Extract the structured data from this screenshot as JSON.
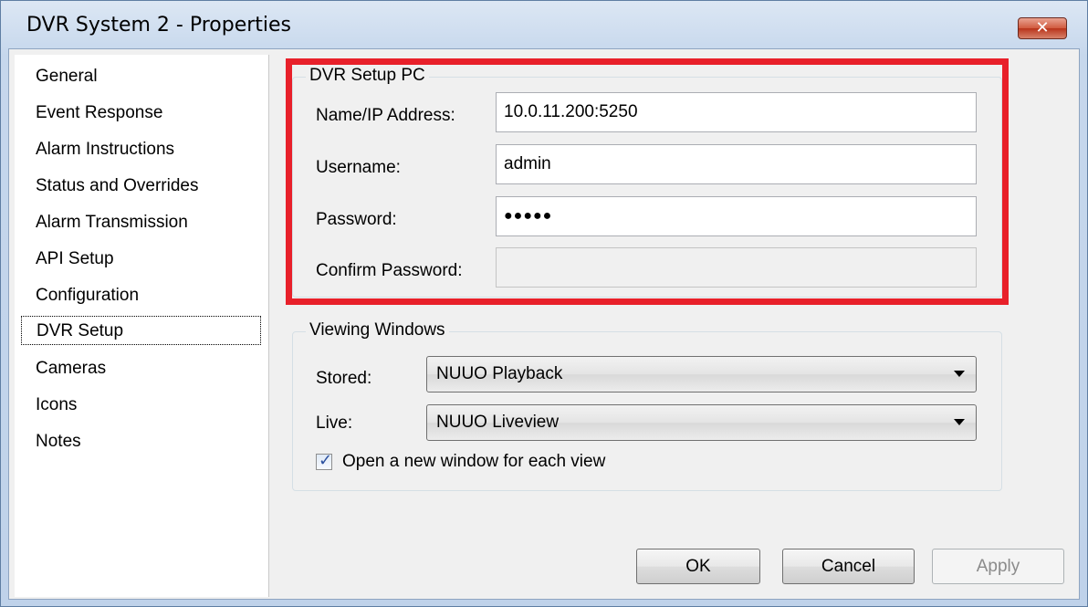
{
  "window": {
    "title": "DVR System 2 - Properties",
    "close_glyph": "✕"
  },
  "sidebar": {
    "items": [
      {
        "label": "General"
      },
      {
        "label": "Event Response"
      },
      {
        "label": "Alarm Instructions"
      },
      {
        "label": "Status and Overrides"
      },
      {
        "label": "Alarm Transmission"
      },
      {
        "label": "API Setup"
      },
      {
        "label": "Configuration"
      },
      {
        "label": "DVR Setup",
        "selected": true
      },
      {
        "label": "Cameras"
      },
      {
        "label": "Icons"
      },
      {
        "label": "Notes"
      }
    ]
  },
  "dvr_setup_pc": {
    "group_label": "DVR Setup PC",
    "name_ip_label": "Name/IP Address:",
    "name_ip_value": "10.0.11.200:5250",
    "username_label": "Username:",
    "username_value": "admin",
    "password_label": "Password:",
    "password_value": "●●●●●",
    "confirm_password_label": "Confirm Password:",
    "confirm_password_value": ""
  },
  "viewing_windows": {
    "group_label": "Viewing Windows",
    "stored_label": "Stored:",
    "stored_value": "NUUO Playback",
    "live_label": "Live:",
    "live_value": "NUUO Liveview",
    "open_new_window_label": "Open a new window for each view",
    "open_new_window_checked": true
  },
  "buttons": {
    "ok": "OK",
    "cancel": "Cancel",
    "apply": "Apply"
  },
  "colors": {
    "highlight": "#e8202a",
    "close_button": "#c7452a",
    "checkmark": "#2a4f9e"
  },
  "icons": {
    "close": "close-icon",
    "dropdown": "chevron-down-icon",
    "checkbox": "checkmark-icon"
  }
}
